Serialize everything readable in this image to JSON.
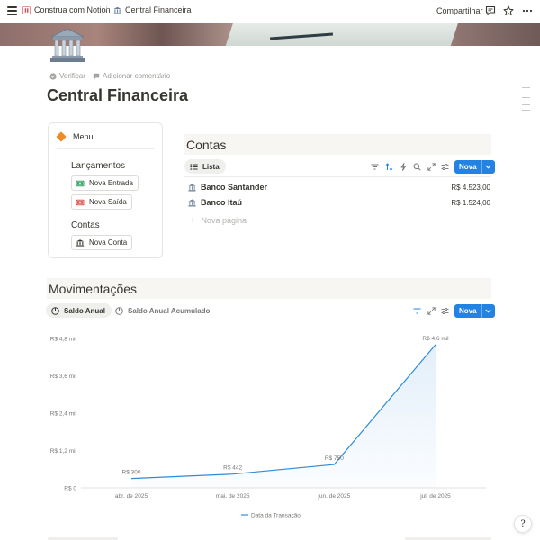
{
  "topbar": {
    "breadcrumb": [
      {
        "label": "Construa com Notion",
        "icon": "notion-logo-icon"
      },
      {
        "label": "Central Financeira",
        "icon": "bank-icon"
      }
    ],
    "separator": "/",
    "share_label": "Compartilhar"
  },
  "page": {
    "icon": "bank-icon",
    "verify_label": "Verificar",
    "comment_label": "Adicionar comentário",
    "title": "Central Financeira"
  },
  "menu": {
    "title": "Menu",
    "sections": [
      {
        "label": "Lançamentos",
        "buttons": [
          {
            "label": "Nova Entrada",
            "icon": "money-in-icon"
          },
          {
            "label": "Nova Saída",
            "icon": "money-out-icon"
          }
        ]
      },
      {
        "label": "Contas",
        "buttons": [
          {
            "label": "Nova Conta",
            "icon": "bank-icon"
          }
        ]
      }
    ]
  },
  "contas": {
    "title": "Contas",
    "view_label": "Lista",
    "new_label": "Nova",
    "accounts": [
      {
        "name": "Banco Santander",
        "value": "R$ 4.523,00"
      },
      {
        "name": "Banco Itaú",
        "value": "R$ 1.524,00"
      }
    ],
    "new_page_label": "Nova página"
  },
  "movimentacoes": {
    "title": "Movimentações",
    "tabs": [
      "Saldo Anual",
      "Saldo Anual Acumulado"
    ],
    "active_tab": 0,
    "new_label": "Nova"
  },
  "chart_data": {
    "type": "area",
    "categories": [
      "abr. de 2025",
      "mai. de 2025",
      "jun. de 2025",
      "jul. de 2025"
    ],
    "series": [
      {
        "name": "Data da Transação",
        "values": [
          300,
          442,
          750,
          4600
        ]
      }
    ],
    "data_labels": [
      "R$ 300",
      "R$ 442",
      "R$ 750",
      "R$ 4,6 mil"
    ],
    "y_ticks": [
      0,
      1200,
      2400,
      3600,
      4800
    ],
    "y_tick_labels": [
      "R$ 0",
      "R$ 1,2 mil",
      "R$ 2,4 mil",
      "R$ 3,6 mil",
      "R$ 4,8 mil"
    ],
    "ylim": [
      0,
      4800
    ],
    "grid": false,
    "legend": "bottom",
    "color": "#2f8bd8"
  },
  "colors": {
    "accent": "#2383e2",
    "menu_diamond": "#f08a24",
    "section_bg": "#f7f6f3"
  }
}
